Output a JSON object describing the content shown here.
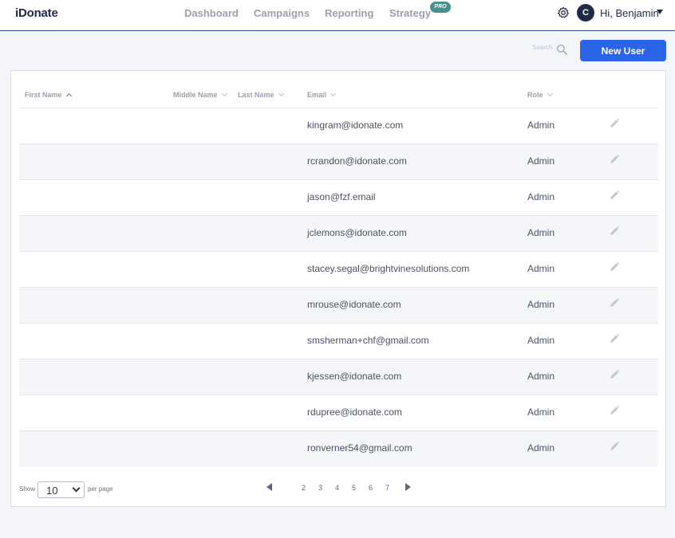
{
  "header": {
    "logo": "iDonate",
    "nav": [
      {
        "label": "Dashboard"
      },
      {
        "label": "Campaigns"
      },
      {
        "label": "Reporting"
      },
      {
        "label": "Strategy"
      }
    ],
    "pro_badge": "PRO",
    "avatar_initial": "C",
    "greeting": "Hi, Benjamin"
  },
  "toolbar": {
    "search_label": "Search",
    "new_user_label": "New User",
    "primary_color": "#2a64e8"
  },
  "table": {
    "columns": [
      "First Name",
      "Middle Name",
      "Last Name",
      "Email",
      "Role"
    ],
    "sorted_column": "First Name",
    "rows": [
      {
        "email": "kingram@idonate.com",
        "role": "Admin"
      },
      {
        "email": "rcrandon@idonate.com",
        "role": "Admin"
      },
      {
        "email": "jason@fzf.email",
        "role": "Admin"
      },
      {
        "email": "jclemons@idonate.com",
        "role": "Admin"
      },
      {
        "email": "stacey.segal@brightvinesolutions.com",
        "role": "Admin"
      },
      {
        "email": "mrouse@idonate.com",
        "role": "Admin"
      },
      {
        "email": "smsherman+chf@gmail.com",
        "role": "Admin"
      },
      {
        "email": "kjessen@idonate.com",
        "role": "Admin"
      },
      {
        "email": "rdupree@idonate.com",
        "role": "Admin"
      },
      {
        "email": "ronverner54@gmail.com",
        "role": "Admin"
      }
    ]
  },
  "pagination": {
    "show_label": "Show",
    "per_page_value": "10",
    "per_page_label": "per page",
    "pages": [
      "2",
      "3",
      "4",
      "5",
      "6",
      "7"
    ]
  }
}
